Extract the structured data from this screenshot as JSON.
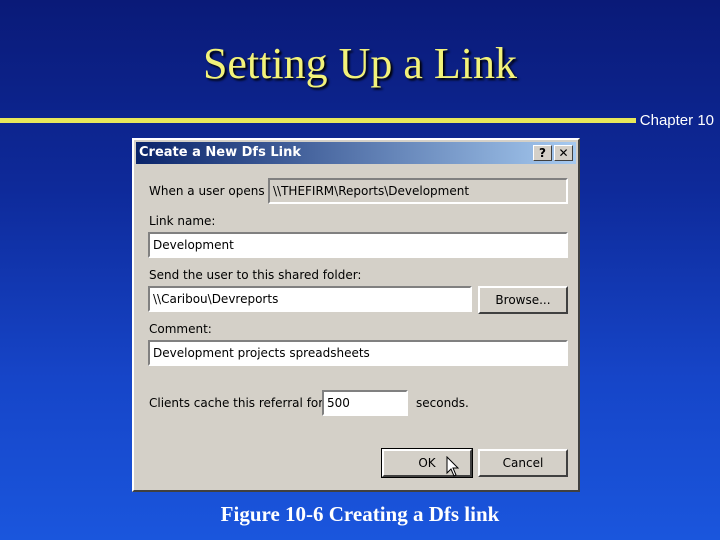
{
  "slide": {
    "title": "Setting Up a Link",
    "chapter": "Chapter 10",
    "caption": "Figure 10-6  Creating a Dfs link"
  },
  "dialog": {
    "title": "Create a New Dfs Link",
    "help_btn": "?",
    "close_btn": "✕",
    "user_opens_label": "When a user opens",
    "user_opens_value": "\\\\THEFIRM\\Reports\\Development",
    "link_name_label": "Link name:",
    "link_name_value": "Development",
    "shared_folder_label": "Send the user to this shared folder:",
    "shared_folder_value": "\\\\Caribou\\Devreports",
    "browse_label": "Browse...",
    "comment_label": "Comment:",
    "comment_value": "Development projects spreadsheets",
    "cache_label": "Clients cache this referral for",
    "cache_value": "500",
    "cache_unit": "seconds.",
    "ok_label": "OK",
    "cancel_label": "Cancel"
  },
  "colors": {
    "title": "#f2f27a",
    "rule": "#e8e85a",
    "dialog_bg": "#d4d0c8",
    "titlebar_start": "#0a246a",
    "titlebar_end": "#a6caf0"
  }
}
